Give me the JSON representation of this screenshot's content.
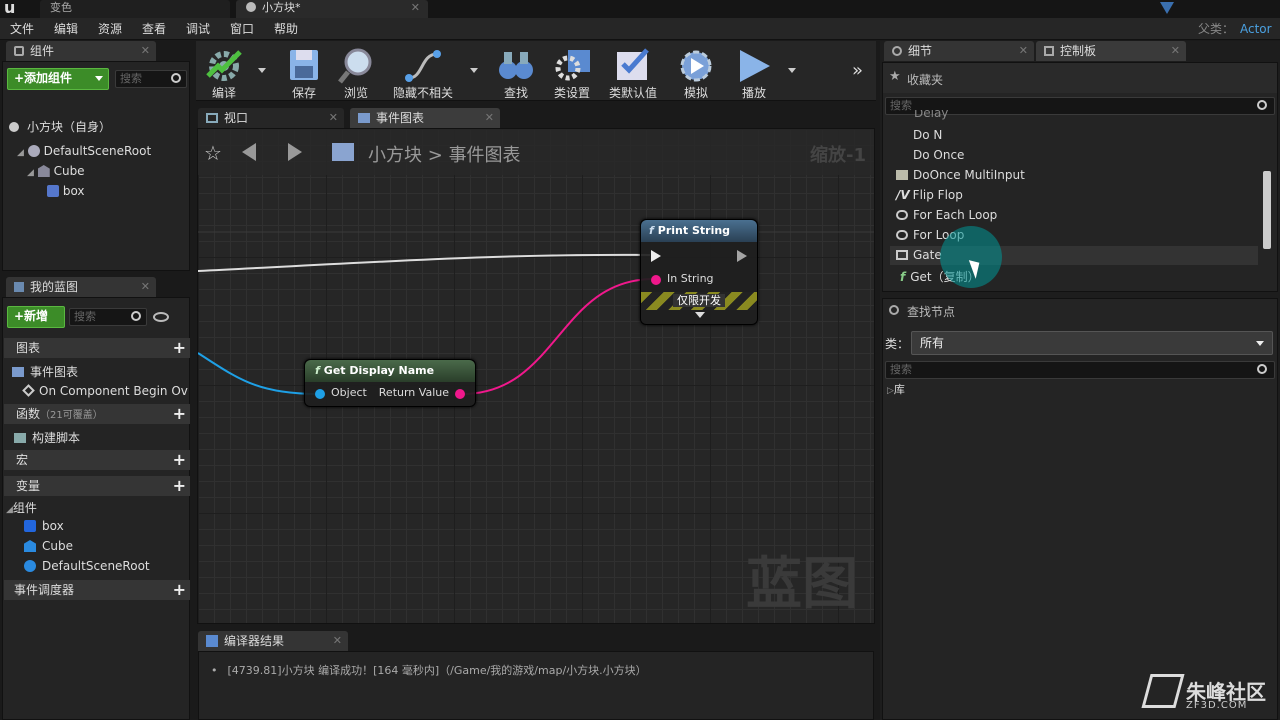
{
  "titlebar": {
    "tab1": "变色",
    "tab2": "小方块*",
    "parent_label": "父类：",
    "parent_value": "Actor"
  },
  "menu": [
    "文件",
    "编辑",
    "资源",
    "查看",
    "调试",
    "窗口",
    "帮助"
  ],
  "components": {
    "tab": "组件",
    "add_button": "+添加组件",
    "search_placeholder": "搜索",
    "self_item": "小方块（自身）",
    "tree": [
      "DefaultSceneRoot",
      "Cube",
      "box"
    ]
  },
  "my_blueprint": {
    "tab": "我的蓝图",
    "new_button": "+新增",
    "search_placeholder": "搜索",
    "graphs": "图表",
    "event_graph": "事件图表",
    "event_item": "On Component Begin Ov",
    "functions": "函数",
    "functions_note": "（21可覆盖）",
    "construct": "构建脚本",
    "macros": "宏",
    "variables": "变量",
    "components_cat": "组件",
    "vars": [
      "box",
      "Cube",
      "DefaultSceneRoot"
    ],
    "dispatchers": "事件调度器"
  },
  "toolbar": [
    "编译",
    "保存",
    "浏览",
    "隐藏不相关",
    "查找",
    "类设置",
    "类默认值",
    "模拟",
    "播放"
  ],
  "viewport_tabs": {
    "viewport": "视口",
    "event_graph": "事件图表"
  },
  "graph": {
    "breadcrumb_root": "小方块",
    "breadcrumb_sep": ">",
    "breadcrumb_leaf": "事件图表",
    "zoom": "缩放-1",
    "watermark": "蓝图"
  },
  "nodes": {
    "print_string": {
      "title": "Print String",
      "pin_in_string": "In String",
      "dev_only": "仅限开发"
    },
    "get_display_name": {
      "title": "Get Display Name",
      "pin_object": "Object",
      "pin_return": "Return Value"
    }
  },
  "compiler": {
    "tab": "编译器结果",
    "message": "[4739.81]小方块 编译成功！[164 毫秒内]（/Game/我的游戏/map/小方块.小方块）"
  },
  "details_tab": "细节",
  "palette": {
    "tab": "控制板",
    "favorites": "收藏夹",
    "search_placeholder": "搜索",
    "items": [
      "Delay",
      "Do N",
      "Do Once",
      "DoOnce MultiInput",
      "Flip Flop",
      "For Each Loop",
      "For Loop",
      "Gate",
      "Get（复制）"
    ],
    "find_node": "查找节点",
    "class_label": "类：",
    "class_value": "所有",
    "search2_placeholder": "搜索",
    "library": "库"
  },
  "watermark_logo": {
    "name": "朱峰社区",
    "url": "ZF3D.COM"
  },
  "colors": {
    "accent_green": "#3c8c28",
    "string_pin": "#f0188c",
    "object_pin": "#1ea0e6",
    "function_header": "#3a5a78"
  }
}
